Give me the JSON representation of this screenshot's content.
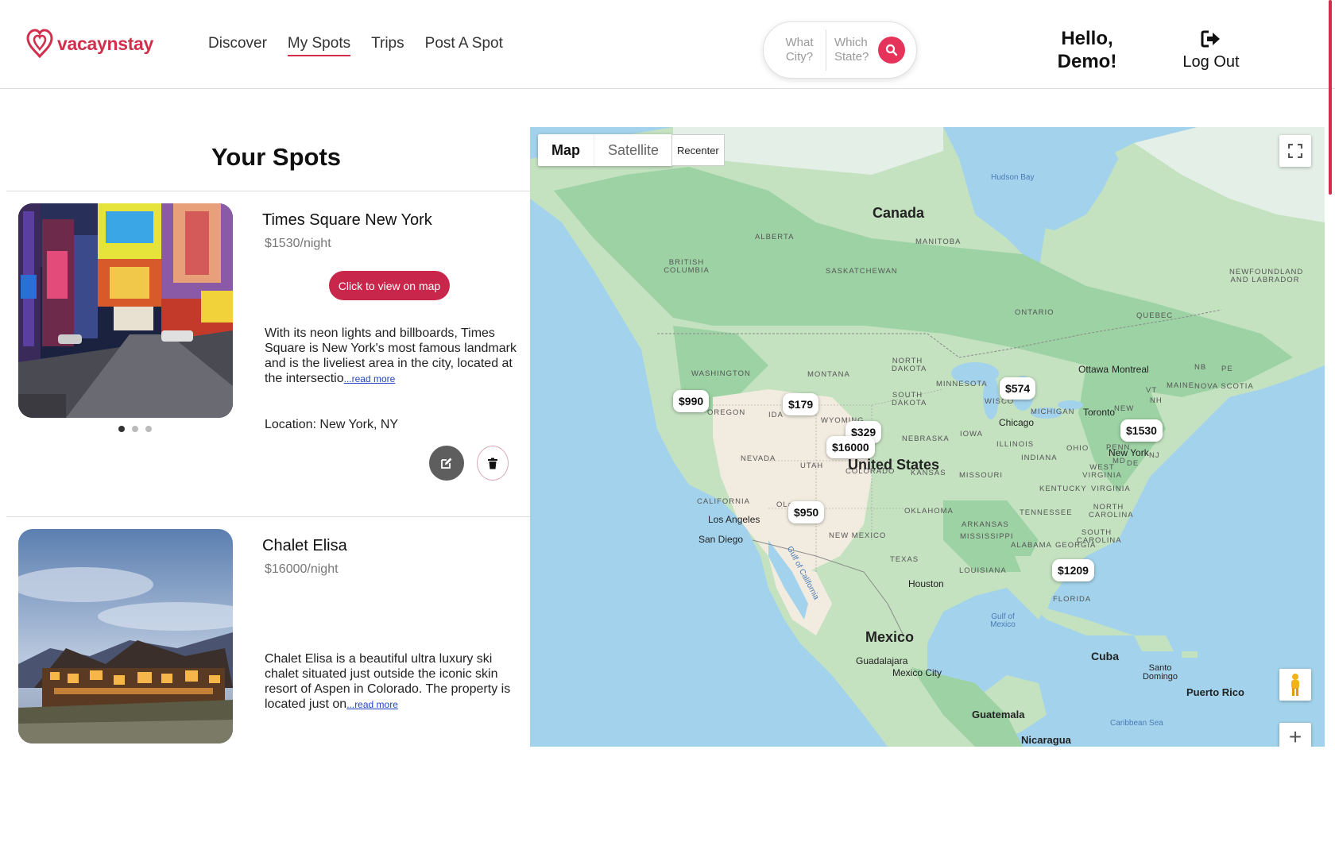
{
  "header": {
    "logo_text": "vacaynstay",
    "nav": [
      {
        "label": "Discover",
        "active": false
      },
      {
        "label": "My Spots",
        "active": true
      },
      {
        "label": "Trips",
        "active": false
      },
      {
        "label": "Post A Spot",
        "active": false
      }
    ],
    "search": {
      "city_placeholder": "What\nCity?",
      "state_placeholder": "Which\nState?",
      "button_icon": "search-icon"
    },
    "greeting": "Hello,\nDemo!",
    "logout_label": "Log Out",
    "logout_icon": "sign-out-icon"
  },
  "list": {
    "title": "Your Spots",
    "spots": [
      {
        "name": "Times Square New York",
        "price": "$1530/night",
        "map_button": "Click to view on map",
        "description": "With its neon lights and billboards, Times Square is New York's most famous landmark and is the liveliest area in the city, located at the intersectio",
        "read_more": "...read more",
        "location": "Location: New York, NY",
        "image_dots": 3,
        "active_dot": 0
      },
      {
        "name": "Chalet Elisa",
        "price": "$16000/night",
        "description": "Chalet Elisa is a beautiful ultra luxury ski chalet situated just outside the iconic skin resort of Aspen in Colorado. The property is located just on",
        "read_more": "...read more"
      }
    ],
    "edit_icon": "edit-icon",
    "delete_icon": "trash-icon"
  },
  "map": {
    "map_type_options": [
      "Map",
      "Satellite"
    ],
    "selected_map_type": "Map",
    "recenter_label": "Recenter",
    "controls": [
      "fullscreen-icon",
      "pegman-icon",
      "zoom-in"
    ],
    "zoom_in_label": "+",
    "price_markers": [
      "$990",
      "$179",
      "$329",
      "$16000",
      "$574",
      "$1530",
      "$950",
      "$1209"
    ],
    "labels": {
      "countries": [
        "Canada",
        "United States",
        "Mexico"
      ],
      "regions": [
        "ALBERTA",
        "BRITISH COLUMBIA",
        "SASKATCHEWAN",
        "MANITOBA",
        "ONTARIO",
        "QUEBEC",
        "NEWFOUNDLAND AND LABRADOR",
        "WASHINGTON",
        "MONTANA",
        "NORTH DAKOTA",
        "MINNESOTA",
        "SOUTH DAKOTA",
        "OREGON",
        "IDA",
        "WYOMING",
        "WISCO",
        "MICHIGAN",
        "NEBRASKA",
        "IOWA",
        "ILLINOIS",
        "NEVADA",
        "UTAH",
        "COLORADO",
        "KANSAS",
        "MISSOURI",
        "INDIANA",
        "OHIO",
        "PENN",
        "NJ",
        "MD",
        "DE",
        "WEST VIRGINIA",
        "KENTUCKY",
        "VIRGINIA",
        "CALIFORNIA",
        "OKLAHOMA",
        "ARKANSAS",
        "TENNESSEE",
        "NORTH CAROLINA",
        "SOUTH CAROLINA",
        "NEW MEXICO",
        "MISSISSIPPI",
        "ALABAMA",
        "GEORGIA",
        "TEXAS",
        "LOUISIANA",
        "FLORIDA",
        "NB",
        "PE",
        "MAINE",
        "NOVA SCOTIA",
        "VT",
        "NH",
        "NEW",
        "OLa"
      ],
      "cities": [
        "Ottawa",
        "Montreal",
        "Toronto",
        "Chicago",
        "New York",
        "Los Angeles",
        "San Diego",
        "Houston",
        "Guadalajara",
        "Mexico City",
        "Cuba",
        "Santo Domingo",
        "Puerto Rico",
        "Guatemala",
        "Nicaragua"
      ],
      "water": [
        "Hudson Bay",
        "Gulf of Mexico",
        "Gulf of California",
        "Caribbean Sea"
      ]
    },
    "colors": {
      "water": "#a3d3ec",
      "forest": "#9dd2a4",
      "land": "#c4e2c0",
      "desert": "#f2ece0",
      "tundra": "#e4efe7"
    }
  },
  "colors": {
    "brand": "#d12f4c",
    "map_button": "#c8264a",
    "search_button": "#e6335a"
  }
}
